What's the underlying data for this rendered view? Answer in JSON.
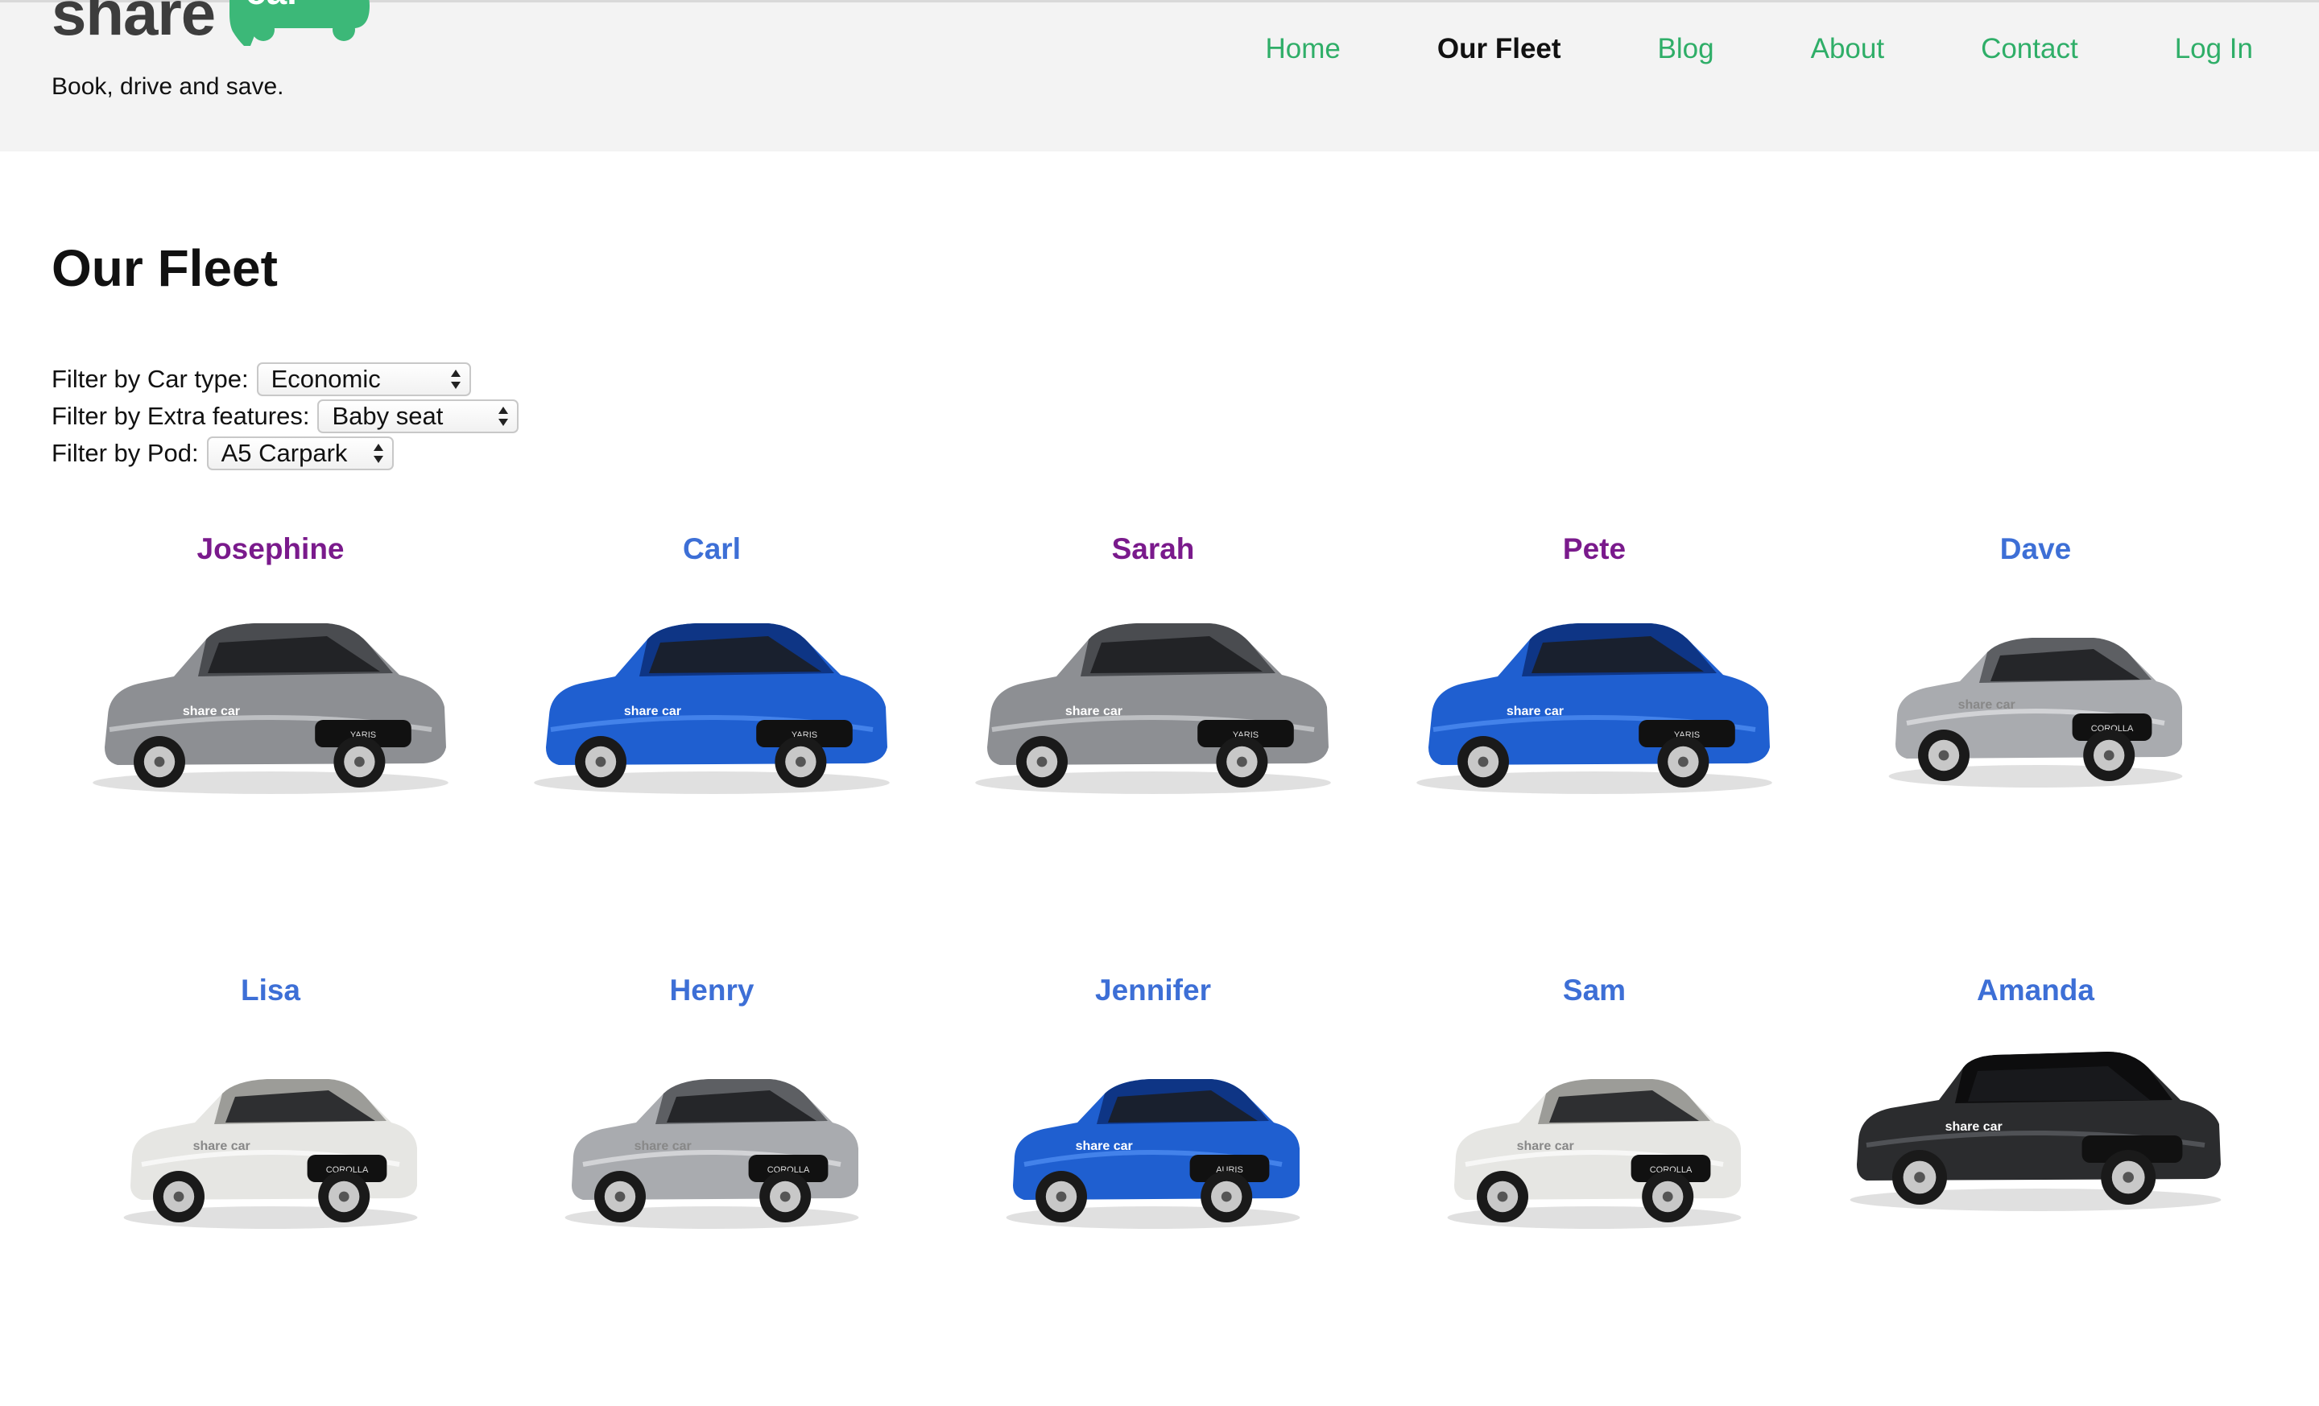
{
  "brand": {
    "word": "share",
    "badge_word": "car",
    "tagline": "Book, drive and save.",
    "color": "#3cb878"
  },
  "nav": {
    "items": [
      {
        "label": "Home",
        "active": false
      },
      {
        "label": "Our Fleet",
        "active": true
      },
      {
        "label": "Blog",
        "active": false
      },
      {
        "label": "About",
        "active": false
      },
      {
        "label": "Contact",
        "active": false
      },
      {
        "label": "Log In",
        "active": false
      }
    ],
    "link_color": "#2fae68",
    "active_color": "#111111"
  },
  "page": {
    "title": "Our Fleet"
  },
  "filters": {
    "car_type": {
      "label": "Filter by Car type:",
      "value": "Economic"
    },
    "extra_features": {
      "label": "Filter by Extra features:",
      "value": "Baby seat"
    },
    "pod": {
      "label": "Filter by Pod:",
      "value": "A5 Carpark"
    }
  },
  "fleet": [
    {
      "name": "Josephine",
      "visited": true,
      "color": "grey",
      "model": "hatch-small",
      "plate": "YARIS"
    },
    {
      "name": "Carl",
      "visited": false,
      "color": "blue",
      "model": "hatch-small",
      "plate": "YARIS"
    },
    {
      "name": "Sarah",
      "visited": true,
      "color": "grey",
      "model": "hatch-small",
      "plate": "YARIS"
    },
    {
      "name": "Pete",
      "visited": true,
      "color": "blue",
      "model": "hatch-small",
      "plate": "YARIS"
    },
    {
      "name": "Dave",
      "visited": false,
      "color": "silver",
      "model": "hatch",
      "plate": "COROLLA"
    },
    {
      "name": "Lisa",
      "visited": false,
      "color": "white",
      "model": "hatch",
      "plate": "COROLLA"
    },
    {
      "name": "Henry",
      "visited": false,
      "color": "silver",
      "model": "hatch",
      "plate": "COROLLA"
    },
    {
      "name": "Jennifer",
      "visited": false,
      "color": "blue",
      "model": "hatch",
      "plate": "AURIS"
    },
    {
      "name": "Sam",
      "visited": false,
      "color": "white",
      "model": "hatch",
      "plate": "COROLLA"
    },
    {
      "name": "Amanda",
      "visited": false,
      "color": "black",
      "model": "suv",
      "plate": ""
    }
  ],
  "colors": {
    "visited_link": "#7a1a8c",
    "link": "#3d6fd6",
    "header_bg": "#f3f3f3"
  }
}
